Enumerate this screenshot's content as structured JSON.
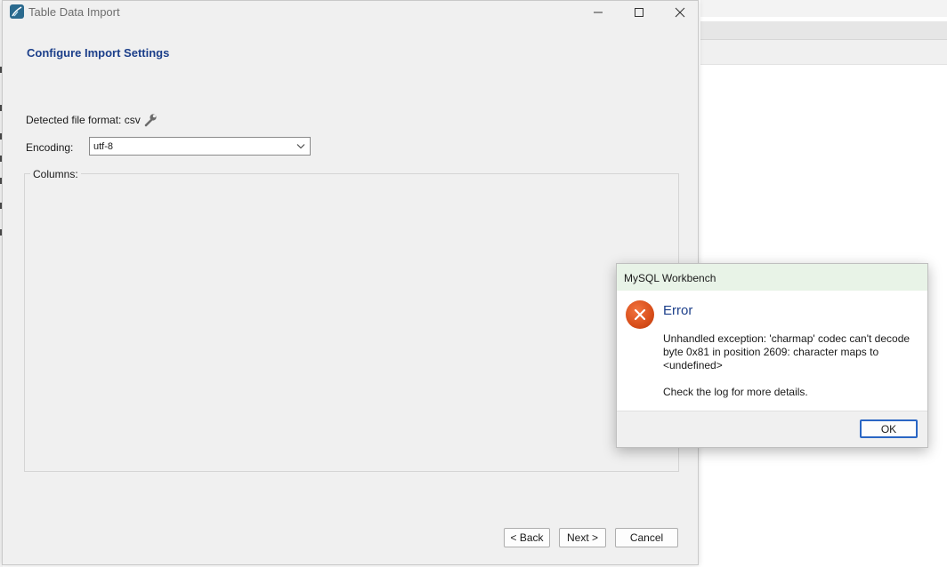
{
  "window": {
    "title": "Table Data Import",
    "page_title": "Configure Import Settings",
    "detected_format_label": "Detected file format: csv",
    "encoding_label": "Encoding:",
    "encoding_value": "utf-8",
    "columns_label": "Columns:",
    "buttons": {
      "back": "< Back",
      "next": "Next >",
      "cancel": "Cancel"
    }
  },
  "dialog": {
    "title": "MySQL Workbench",
    "heading": "Error",
    "message": "Unhandled exception: 'charmap' codec can't decode byte 0x81 in position 2609: character maps to <undefined>",
    "hint": "Check the log for more details.",
    "ok_label": "OK"
  },
  "colors": {
    "heading_blue": "#1c3f8a",
    "error_orange": "#d84e1a",
    "dialog_title_bg": "#e8f3e7",
    "focus_blue": "#2a66c4"
  },
  "icons": [
    "workbench-app-icon",
    "minimize-icon",
    "maximize-icon",
    "close-icon",
    "wrench-icon",
    "chevron-down-icon",
    "error-icon"
  ]
}
